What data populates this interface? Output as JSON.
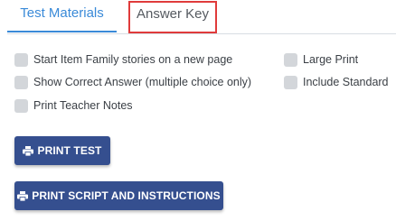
{
  "tabs": {
    "test_materials": "Test Materials",
    "answer_key": "Answer Key"
  },
  "options": {
    "start_item_family": "Start Item Family stories on a new page",
    "show_correct_answer": "Show Correct Answer (multiple choice only)",
    "print_teacher_notes": "Print Teacher Notes",
    "large_print": "Large Print",
    "include_standard": "Include Standard"
  },
  "buttons": {
    "print_test": "PRINT TEST",
    "print_script": "PRINT SCRIPT AND INSTRUCTIONS",
    "icon": "printer-icon"
  },
  "colors": {
    "accent": "#3a8ad8",
    "highlight_border": "#e03b3b",
    "button_bg": "#354f8f",
    "checkbox_bg": "#d3d6da"
  }
}
